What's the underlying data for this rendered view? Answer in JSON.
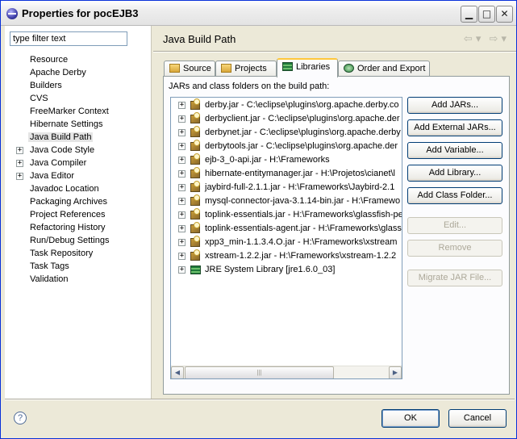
{
  "window": {
    "title": "Properties for pocEJB3"
  },
  "filter": {
    "placeholder": "type filter text"
  },
  "tree": [
    {
      "label": "Resource",
      "expandable": false
    },
    {
      "label": "Apache Derby",
      "expandable": false
    },
    {
      "label": "Builders",
      "expandable": false
    },
    {
      "label": "CVS",
      "expandable": false
    },
    {
      "label": "FreeMarker Context",
      "expandable": false
    },
    {
      "label": "Hibernate Settings",
      "expandable": false
    },
    {
      "label": "Java Build Path",
      "expandable": false,
      "selected": true
    },
    {
      "label": "Java Code Style",
      "expandable": true
    },
    {
      "label": "Java Compiler",
      "expandable": true
    },
    {
      "label": "Java Editor",
      "expandable": true
    },
    {
      "label": "Javadoc Location",
      "expandable": false
    },
    {
      "label": "Packaging Archives",
      "expandable": false
    },
    {
      "label": "Project References",
      "expandable": false
    },
    {
      "label": "Refactoring History",
      "expandable": false
    },
    {
      "label": "Run/Debug Settings",
      "expandable": false
    },
    {
      "label": "Task Repository",
      "expandable": false
    },
    {
      "label": "Task Tags",
      "expandable": false
    },
    {
      "label": "Validation",
      "expandable": false
    }
  ],
  "page": {
    "title": "Java Build Path"
  },
  "tabs": [
    {
      "label": "Source",
      "icon": "source-folder-icon"
    },
    {
      "label": "Projects",
      "icon": "projects-icon"
    },
    {
      "label": "Libraries",
      "icon": "libraries-icon",
      "active": true
    },
    {
      "label": "Order and Export",
      "icon": "order-export-icon"
    }
  ],
  "libraries": {
    "caption": "JARs and class folders on the build path:",
    "items": [
      {
        "label": "derby.jar - C:\\eclipse\\plugins\\org.apache.derby.co",
        "icon": "jar-icon"
      },
      {
        "label": "derbyclient.jar - C:\\eclipse\\plugins\\org.apache.der",
        "icon": "jar-icon"
      },
      {
        "label": "derbynet.jar - C:\\eclipse\\plugins\\org.apache.derby",
        "icon": "jar-icon"
      },
      {
        "label": "derbytools.jar - C:\\eclipse\\plugins\\org.apache.der",
        "icon": "jar-icon"
      },
      {
        "label": "ejb-3_0-api.jar - H:\\Frameworks",
        "icon": "jar-icon"
      },
      {
        "label": "hibernate-entitymanager.jar - H:\\Projetos\\cianet\\l",
        "icon": "jar-icon"
      },
      {
        "label": "jaybird-full-2.1.1.jar - H:\\Frameworks\\Jaybird-2.1",
        "icon": "jar-icon"
      },
      {
        "label": "mysql-connector-java-3.1.14-bin.jar - H:\\Framewo",
        "icon": "jar-icon"
      },
      {
        "label": "toplink-essentials.jar - H:\\Frameworks\\glassfish-pe",
        "icon": "jar-icon"
      },
      {
        "label": "toplink-essentials-agent.jar - H:\\Frameworks\\glass",
        "icon": "jar-icon"
      },
      {
        "label": "xpp3_min-1.1.3.4.O.jar - H:\\Frameworks\\xstream",
        "icon": "jar-icon"
      },
      {
        "label": "xstream-1.2.2.jar - H:\\Frameworks\\xstream-1.2.2",
        "icon": "jar-icon"
      },
      {
        "label": "JRE System Library [jre1.6.0_03]",
        "icon": "jre-library-icon"
      }
    ]
  },
  "buttons": {
    "add_jars": "Add JARs...",
    "add_external_jars": "Add External JARs...",
    "add_variable": "Add Variable...",
    "add_library": "Add Library...",
    "add_class_folder": "Add Class Folder...",
    "edit": "Edit...",
    "remove": "Remove",
    "migrate_jar": "Migrate JAR File...",
    "ok": "OK",
    "cancel": "Cancel"
  }
}
